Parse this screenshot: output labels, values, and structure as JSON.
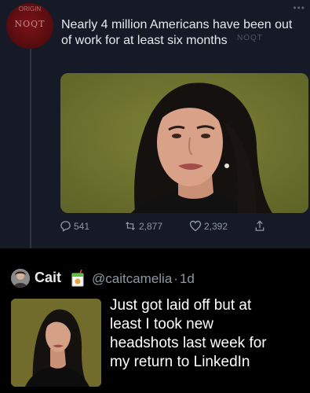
{
  "quoted_tweet": {
    "faded_header": "",
    "badge_top_text": "ORIGIN",
    "badge_text": "NOQT",
    "headline_line1": "Nearly 4 million Americans have been out",
    "headline_line2": "of work for at least six months",
    "headline_overlay": "NOQT",
    "more_icon": "more-horizontal-icon",
    "actions": {
      "replies": "541",
      "retweets": "2,877",
      "likes": "2,392"
    }
  },
  "tweet": {
    "author_name": "Cait",
    "author_emoji": "juice-box-icon",
    "handle": "@caitcamelia",
    "separator": "·",
    "time": "1d",
    "text_lines": [
      "Just got laid off but at",
      "least I took new",
      "headshots last week for",
      "my return to LinkedIn"
    ]
  },
  "colors": {
    "panel_bg": "#161a26",
    "page_bg": "#000000",
    "photo_bg": "#6f7430",
    "muted_text": "#8b98a5"
  }
}
